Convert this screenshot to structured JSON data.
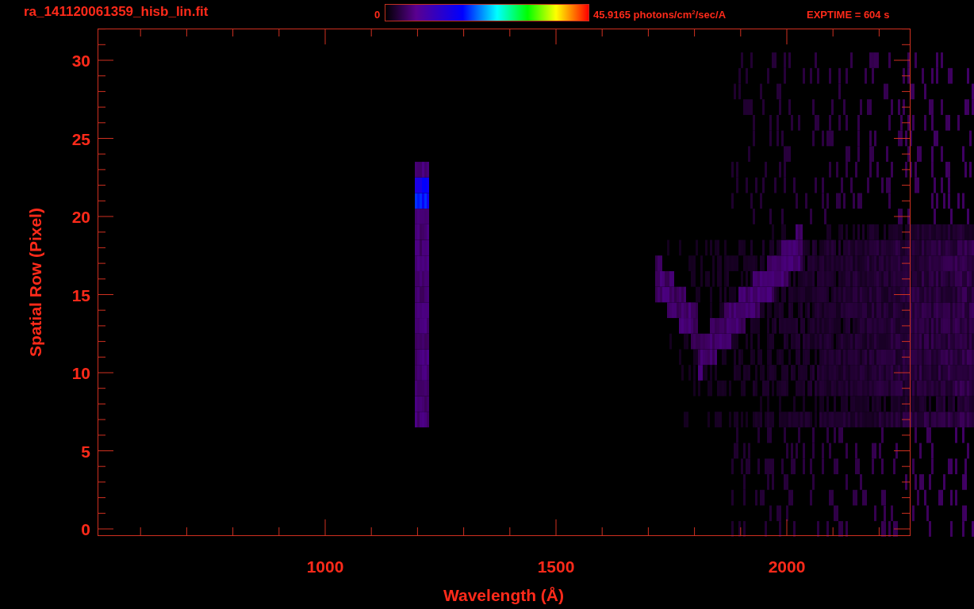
{
  "title": "ra_141120061359_hisb_lin.fit",
  "colorbar": {
    "min_label": "0",
    "max_label": "45.9165 photons/cm$^{2}$/sec/A"
  },
  "exposure": "EXPTIME = 604 s",
  "x_axis": {
    "label": "Wavelength (Å)",
    "ticks": [
      "1000",
      "1500",
      "2000"
    ]
  },
  "y_axis": {
    "label": "Spatial Row (Pixel)",
    "ticks": [
      "30",
      "25",
      "20",
      "15",
      "10",
      "5",
      "0"
    ]
  }
}
